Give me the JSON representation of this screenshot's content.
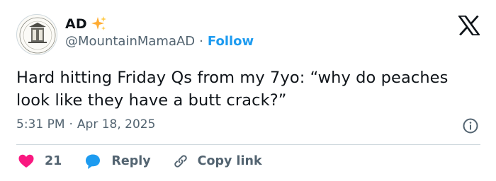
{
  "author": {
    "name": "AD",
    "name_emoji": "sparkles-emoji",
    "handle": "@MountainMamaAD",
    "separator": "·",
    "follow_label": "Follow"
  },
  "tweet": {
    "text": "Hard hitting Friday Qs from my 7yo: “why do peaches look like they have a butt crack?”",
    "time": "5:31 PM",
    "separator": "·",
    "date": "Apr 18, 2025"
  },
  "actions": {
    "like_count": "21",
    "reply_label": "Reply",
    "copy_label": "Copy link"
  },
  "colors": {
    "accent": "#1d9bf0",
    "like": "#f91880",
    "text": "#0f1419",
    "muted": "#536471",
    "sparkle": "#ffac33"
  },
  "icons": [
    "x-logo-icon",
    "info-icon",
    "heart-icon",
    "speech-bubble-icon",
    "link-icon",
    "sparkles-emoji"
  ]
}
